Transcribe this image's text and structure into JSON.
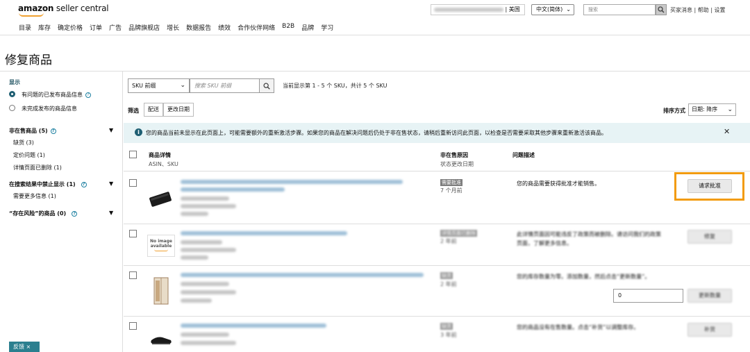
{
  "header": {
    "logo_bold": "amazon",
    "logo_rest": " seller central",
    "nav": [
      "目录",
      "库存",
      "确定价格",
      "订单",
      "广告",
      "品牌旗舰店",
      "增长",
      "数据报告",
      "绩效",
      "合作伙伴网络",
      "B2B",
      "品牌",
      "学习"
    ],
    "marketplace": "美国",
    "language": "中文(简体)",
    "search_placeholder": "搜索",
    "links": "买家消息 | 帮助 | 设置"
  },
  "page_title": "修复商品",
  "sidebar": {
    "display_heading": "显示",
    "radio1": "有问题的已发布商品信息",
    "radio2": "未完成发布的商品信息",
    "unsellable_heading": "非在售商品 (5)",
    "unsellable_items": [
      "缺货 (3)",
      "定价问题 (1)",
      "详情页面已删除 (1)"
    ],
    "suppressed_heading": "在搜索结果中禁止显示 (1)",
    "suppressed_items": [
      "需要更多信息 (1)"
    ],
    "at_risk_heading": "“存在风险”的商品 (0)",
    "feedback": "反馈 ×"
  },
  "toolbar": {
    "sku_select": "SKU 前缀",
    "sku_placeholder": "搜索 SKU 前缀",
    "count_text": "当前显示第 1 - 5 个 SKU，共计 5 个 SKU",
    "filter_label": "筛选",
    "filter_buttons": [
      "配送",
      "更改日期"
    ],
    "sort_label": "排序方式",
    "sort_value": "日期: 降序"
  },
  "banner": {
    "text": "您的商品当前未显示在此页面上，可能需要额外的重新激活步骤。如果您的商品在解决问题后仍处于非在售状态，请稍后重新访问此页面，以检查是否需要采取其他步骤来重新激活该商品。"
  },
  "table": {
    "col1": "商品详情",
    "col1_sub": "ASIN、SKU",
    "col2": "非在售原因",
    "col2_sub": "状态更改日期",
    "col3": "问题描述",
    "rows": [
      {
        "badge": "需要批准",
        "date": "7 个月前",
        "description": "您的商品需要获得批准才能销售。",
        "action": "请求批准"
      },
      {
        "badge": "详情页面已删除",
        "date": "2 年前",
        "description": "此详情页面因可能违反了政策而被删除。请访问我们的政策",
        "description2": "页面，了解更多信息。",
        "action": "修复",
        "no_image": "No image available"
      },
      {
        "badge": "缺货",
        "date": "2 年前",
        "description": "您的库存数量为零。添加数量，然后点击“更新数量”。",
        "qty": "0",
        "action": "更新数量"
      },
      {
        "badge": "缺货",
        "date": "3 年前",
        "description": "您的商品没有在售数量。点击“补货”以调整库存。",
        "action": "补货"
      }
    ]
  }
}
